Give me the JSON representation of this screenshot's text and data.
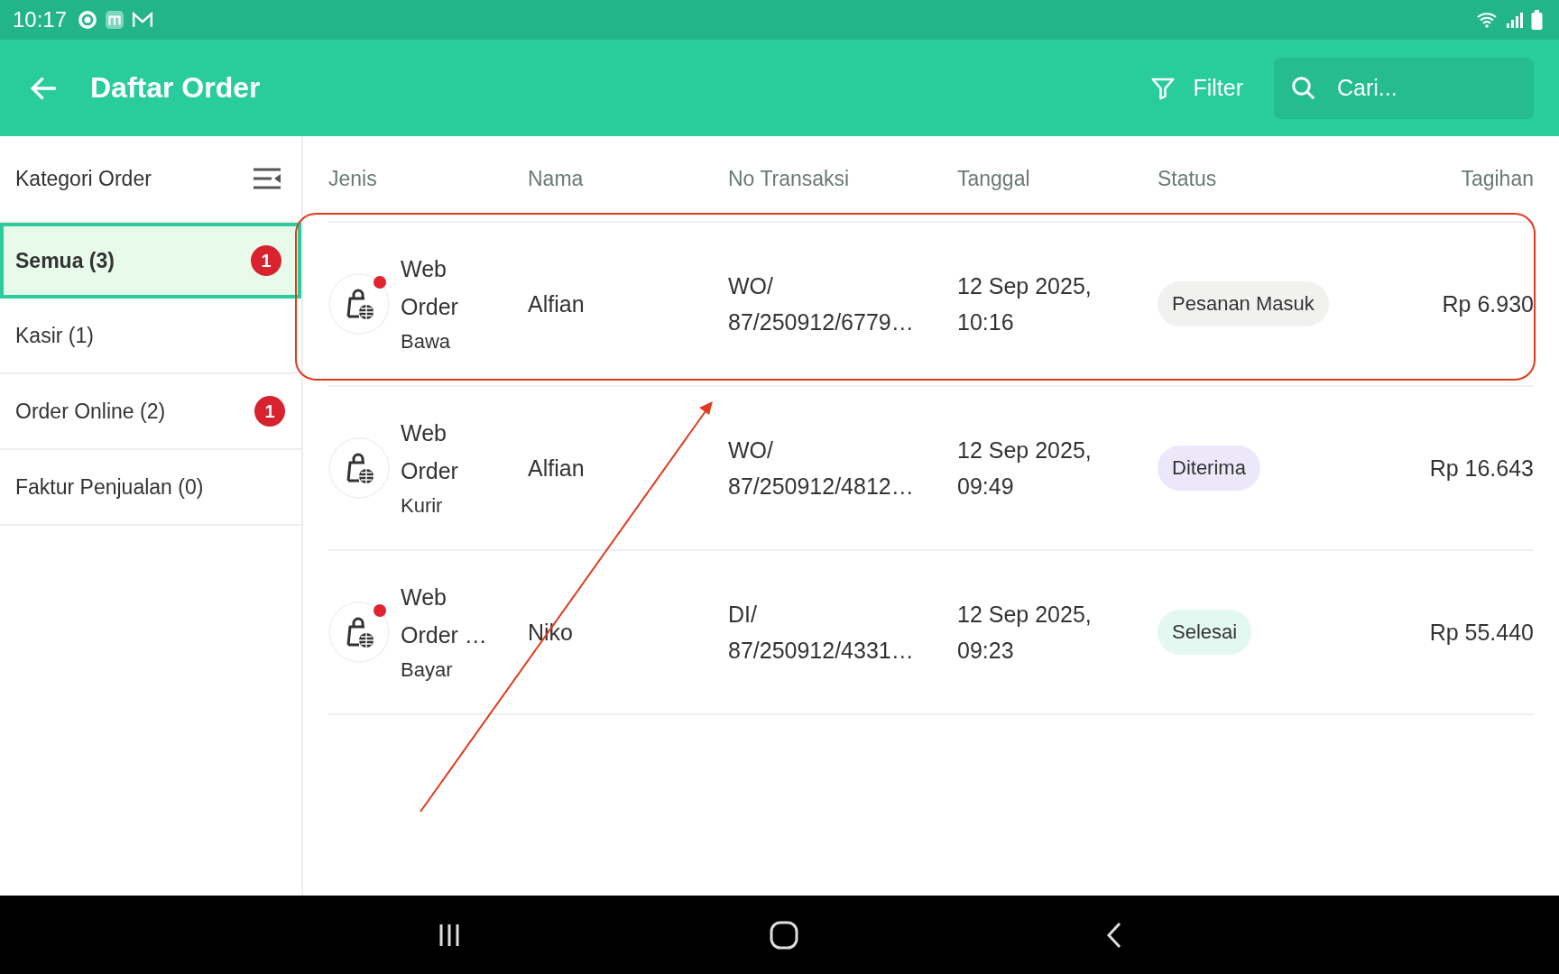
{
  "status_bar": {
    "time": "10:17"
  },
  "header": {
    "title": "Daftar Order",
    "filter_label": "Filter",
    "search": {
      "placeholder": "Cari..."
    }
  },
  "sidebar": {
    "title": "Kategori Order",
    "items": [
      {
        "label": "Semua (3)",
        "selected": true,
        "badge": "1"
      },
      {
        "label": "Kasir (1)",
        "selected": false
      },
      {
        "label": "Order Online (2)",
        "selected": false,
        "badge": "1"
      },
      {
        "label": "Faktur Penjualan (0)",
        "selected": false
      }
    ]
  },
  "table": {
    "columns": [
      "Jenis",
      "Nama",
      "No Transaksi",
      "Tanggal",
      "Status",
      "Tagihan"
    ],
    "rows": [
      {
        "jenis": "Web Order",
        "sub": "Bawa",
        "unread": true,
        "nama": "Alfian",
        "no_transaksi": "WO/ 87/250912/6779…",
        "tanggal": "12 Sep 2025, 10:16",
        "status": "Pesanan Masuk",
        "color": "#f1f2f0",
        "tagihan": "Rp 6.930"
      },
      {
        "jenis": "Web Order",
        "sub": "Kurir",
        "unread": false,
        "nama": "Alfian",
        "no_transaksi": "WO/ 87/250912/4812…",
        "tanggal": "12 Sep 2025, 09:49",
        "status": "Diterima",
        "color": "#ece8fa",
        "tagihan": "Rp 16.643"
      },
      {
        "jenis": "Web Order …",
        "sub": "Bayar",
        "unread": true,
        "nama": "Niko",
        "no_transaksi": "DI/ 87/250912/4331…",
        "tanggal": "12 Sep 2025, 09:23",
        "status": "Selesai",
        "color": "#e2f8f0",
        "tagihan": "Rp 55.440"
      }
    ]
  }
}
